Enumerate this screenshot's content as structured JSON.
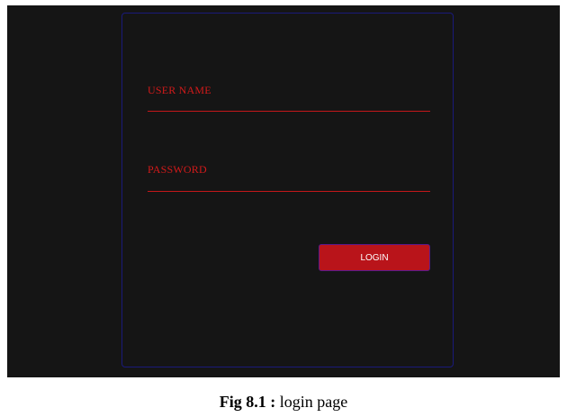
{
  "login_form": {
    "username_label": "USER NAME",
    "password_label": "PASSWORD",
    "login_button_label": "LOGIN"
  },
  "caption": {
    "figure_label": "Fig 8.1 :",
    "text": "login page"
  },
  "colors": {
    "background": "#151515",
    "accent": "#c4171a",
    "card_border": "#1a1a7a",
    "button_text": "#ffffff"
  }
}
